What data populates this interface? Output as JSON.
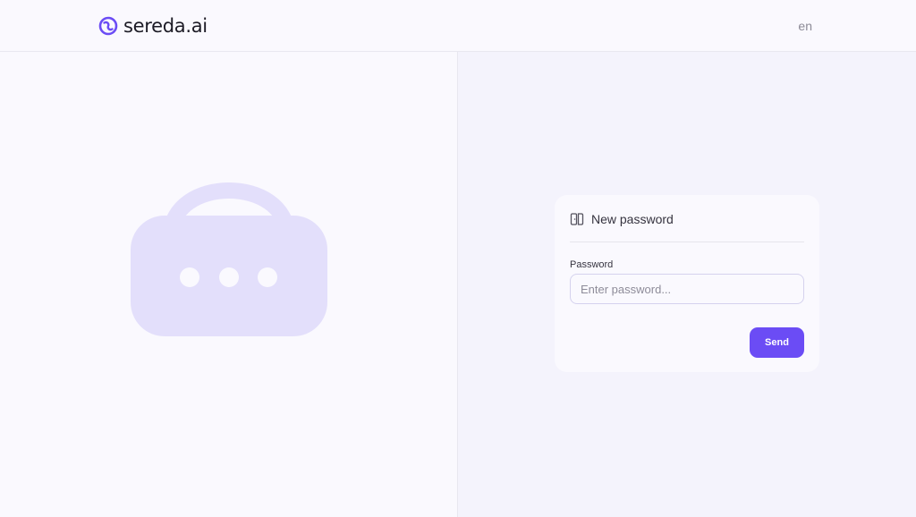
{
  "header": {
    "brand": "sereda.ai",
    "logo_icon": "sereda-logo-icon",
    "language": "en"
  },
  "illustration": {
    "icon": "lock-icon"
  },
  "card": {
    "icon": "door-icon",
    "title": "New password",
    "password_label": "Password",
    "password_placeholder": "Enter password...",
    "password_value": "",
    "send_label": "Send"
  },
  "colors": {
    "accent": "#6b4cf5",
    "lock_fill": "#e3dffb",
    "background": "#faf9fe",
    "pane_background": "#f4f3fc"
  }
}
